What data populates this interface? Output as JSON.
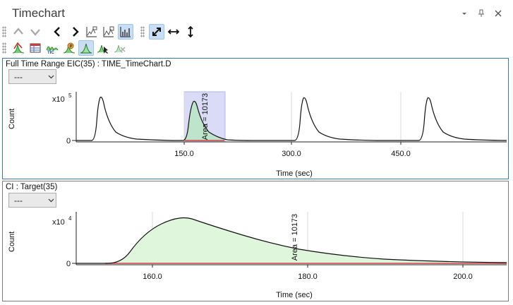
{
  "window": {
    "title": "Timechart",
    "controls": [
      "dropdown-arrow",
      "pin",
      "close"
    ]
  },
  "toolbar": {
    "row1": [
      "up-arrow-icon",
      "down-arrow-icon",
      "previous-icon",
      "next-icon",
      "overlay-chart-icon",
      "stacked-chart-icon",
      "bar-chart-icon",
      "autoscale-both-icon",
      "autoscale-x-icon",
      "autoscale-y-icon"
    ],
    "row2": [
      "peak-detect-icon",
      "spectrum-table-icon",
      "tic-icon",
      "peak-label-icon",
      "integrate-icon",
      "cursor-peak-icon",
      "clear-peak-icon"
    ]
  },
  "panel1": {
    "title": "Full Time Range EIC(35) : TIME_TimeChart.D",
    "dropdown_value": "---",
    "y_label": "Count",
    "y_multiplier": "x10",
    "y_exponent": "5",
    "x_label": "Time (sec)",
    "x_ticks": [
      "150.0",
      "300.0",
      "450.0"
    ],
    "y_ticks": [
      "0"
    ],
    "area_label": "Area = 10173"
  },
  "panel2": {
    "title": "CI : Target(35)",
    "dropdown_value": "---",
    "y_label": "Count",
    "y_multiplier": "x10",
    "y_exponent": "4",
    "x_label": "Time (sec)",
    "x_ticks": [
      "160.0",
      "180.0",
      "200.0"
    ],
    "y_ticks": [
      "0"
    ],
    "area_label": "Area = 10173"
  },
  "colors": {
    "accent": "#3a78b8",
    "selection_fill": "#d9dbf7",
    "area_fill": "#dff5dc",
    "baseline": "#d04040"
  },
  "chart_data": [
    {
      "type": "line",
      "x_ticks": [
        150,
        300,
        450
      ],
      "peak_times_sec": [
        30,
        155,
        315,
        490
      ],
      "selected_range_sec": [
        146,
        206
      ],
      "area": 10173
    },
    {
      "type": "area",
      "x_ticks": [
        160,
        180,
        200
      ],
      "xlim": [
        149,
        203
      ],
      "peak_apex_sec": 165,
      "area": 10173
    }
  ]
}
